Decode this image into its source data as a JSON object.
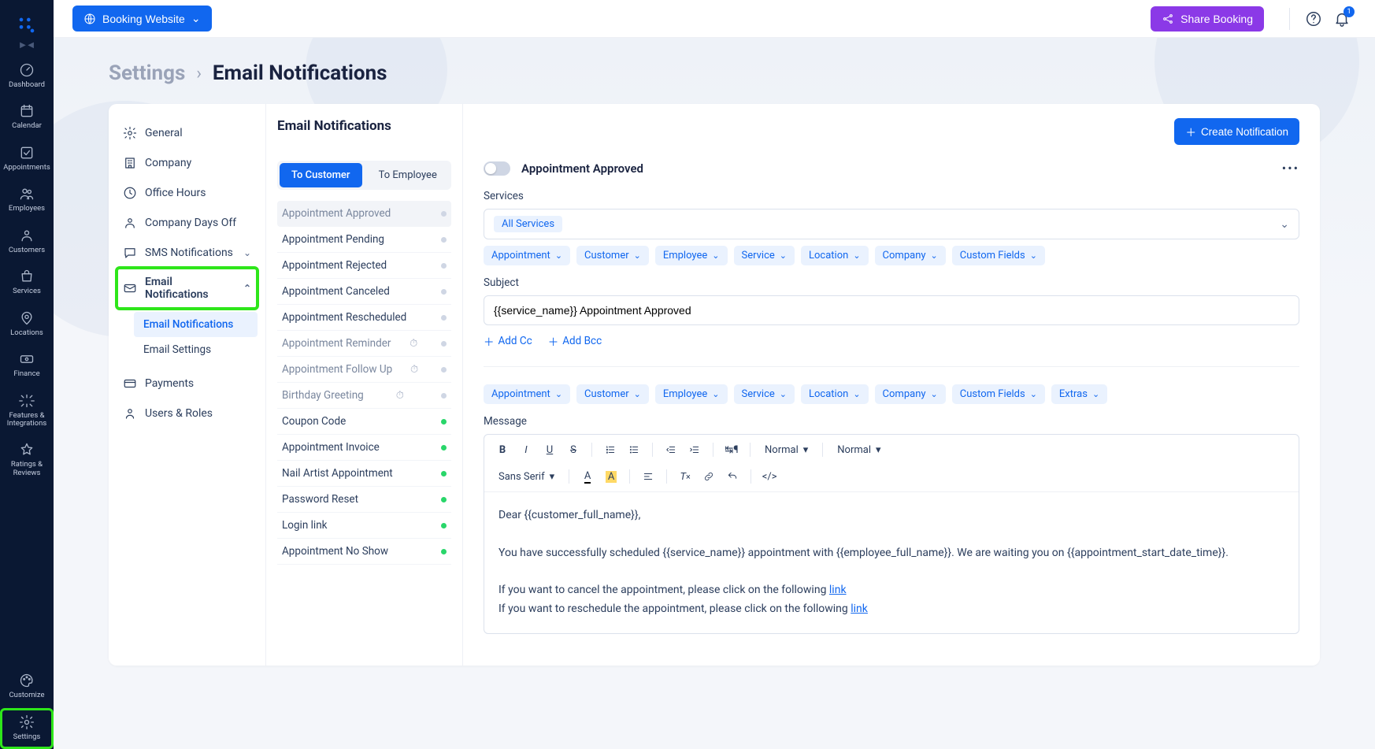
{
  "topbar": {
    "booking_label": "Booking Website",
    "share_label": "Share Booking",
    "notif_badge": "1"
  },
  "nav": {
    "items": [
      {
        "label": "Dashboard"
      },
      {
        "label": "Calendar"
      },
      {
        "label": "Appointments"
      },
      {
        "label": "Employees"
      },
      {
        "label": "Customers"
      },
      {
        "label": "Services"
      },
      {
        "label": "Locations"
      },
      {
        "label": "Finance"
      },
      {
        "label": "Features & Integrations"
      },
      {
        "label": "Ratings & Reviews"
      }
    ],
    "bottom": [
      {
        "label": "Customize"
      },
      {
        "label": "Settings"
      }
    ]
  },
  "breadcrumb": {
    "root": "Settings",
    "sep": "›",
    "current": "Email Notifications"
  },
  "settings_menu": {
    "items": [
      {
        "label": "General"
      },
      {
        "label": "Company"
      },
      {
        "label": "Office Hours"
      },
      {
        "label": "Company Days Off"
      },
      {
        "label": "SMS Notifications"
      },
      {
        "label": "Email Notifications"
      },
      {
        "label": "Payments"
      },
      {
        "label": "Users & Roles"
      }
    ],
    "email_sub": [
      {
        "label": "Email Notifications"
      },
      {
        "label": "Email Settings"
      }
    ]
  },
  "notif_col": {
    "title": "Email Notifications",
    "tabs": {
      "customer": "To Customer",
      "employee": "To Employee"
    },
    "items": [
      {
        "label": "Appointment Approved",
        "dot": "grey",
        "selected": true
      },
      {
        "label": "Appointment Pending",
        "dot": "grey"
      },
      {
        "label": "Appointment Rejected",
        "dot": "grey"
      },
      {
        "label": "Appointment Canceled",
        "dot": "grey"
      },
      {
        "label": "Appointment Rescheduled",
        "dot": "grey"
      },
      {
        "label": "Appointment Reminder",
        "dot": "grey",
        "clock": true,
        "muted": true
      },
      {
        "label": "Appointment Follow Up",
        "dot": "grey",
        "clock": true,
        "muted": true
      },
      {
        "label": "Birthday Greeting",
        "dot": "grey",
        "clock": true,
        "muted": true
      },
      {
        "label": "Coupon Code",
        "dot": "green"
      },
      {
        "label": "Appointment Invoice",
        "dot": "green"
      },
      {
        "label": "Nail Artist Appointment",
        "dot": "green"
      },
      {
        "label": "Password Reset",
        "dot": "green"
      },
      {
        "label": "Login link",
        "dot": "green"
      },
      {
        "label": "Appointment No Show",
        "dot": "green"
      }
    ]
  },
  "editor": {
    "create_label": "Create Notification",
    "toggle_label": "Appointment Approved",
    "services_label": "Services",
    "services_value": "All Services",
    "chips1": [
      "Appointment",
      "Customer",
      "Employee",
      "Service",
      "Location",
      "Company",
      "Custom Fields"
    ],
    "subject_label": "Subject",
    "subject_value": "{{service_name}} Appointment Approved",
    "add_cc": "Add Cc",
    "add_bcc": "Add Bcc",
    "chips2": [
      "Appointment",
      "Customer",
      "Employee",
      "Service",
      "Location",
      "Company",
      "Custom Fields",
      "Extras"
    ],
    "message_label": "Message",
    "rte": {
      "font": "Sans Serif",
      "size": "Normal",
      "heading": "Normal",
      "body_line1": "Dear {{customer_full_name}},",
      "body_line2a": "You have successfully scheduled {{service_name}} appointment with {{employee_full_name}}. We are waiting you on {{appointment_start_date_time}}.",
      "body_line3a": "If you want to cancel the appointment, please click on the following ",
      "body_line3b": "link",
      "body_line4a": "If you want to reschedule the appointment, please click on the following ",
      "body_line4b": "link"
    }
  }
}
